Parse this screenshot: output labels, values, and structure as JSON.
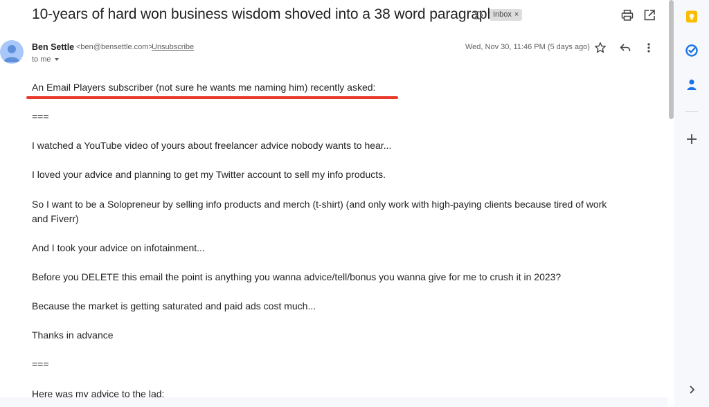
{
  "email": {
    "subject": "10-years of hard won business wisdom shoved into a 38 word paragraph",
    "label": "Inbox",
    "label_close": "×",
    "sender_name": "Ben Settle",
    "sender_email": "<ben@bensettle.com>",
    "unsubscribe": "Unsubscribe",
    "recipient": "to me",
    "date": "Wed, Nov 30, 11:46 PM (5 days ago)"
  },
  "body": {
    "lines": [
      "An Email Players subscriber (not sure he wants me naming him) recently asked:",
      "===",
      "I watched a YouTube video of yours about freelancer advice nobody wants to hear...",
      "I loved your advice and planning to get my Twitter account to sell my info products.",
      "So I want to be a Solopreneur by selling info products and merch (t-shirt) (and only work with high-paying clients because tired of work",
      "and Fiverr)",
      "And I took your advice on infotainment...",
      "Before you DELETE this email the point is anything you wanna advice/tell/bonus you wanna give for me to crush it in 2023?",
      "Because the market is getting saturated and paid ads cost much...",
      "Thanks in advance",
      "===",
      "Here was my advice to the lad:"
    ]
  },
  "icons": {
    "print": "print-icon",
    "open_new_window": "open-in-new-window-icon",
    "star": "star-icon",
    "reply": "reply-icon",
    "more": "more-vert-icon",
    "importance": "importance-marker-icon",
    "keep": "keep-icon",
    "tasks": "tasks-icon",
    "contacts": "contacts-icon",
    "add": "add-icon",
    "expand": "chevron-right-icon"
  },
  "colors": {
    "highlight_underline": "#e8392b",
    "keep": "#fbbc04",
    "tasks": "#1a73e8",
    "contacts": "#1a73e8",
    "avatar": "#a8c7fa"
  }
}
